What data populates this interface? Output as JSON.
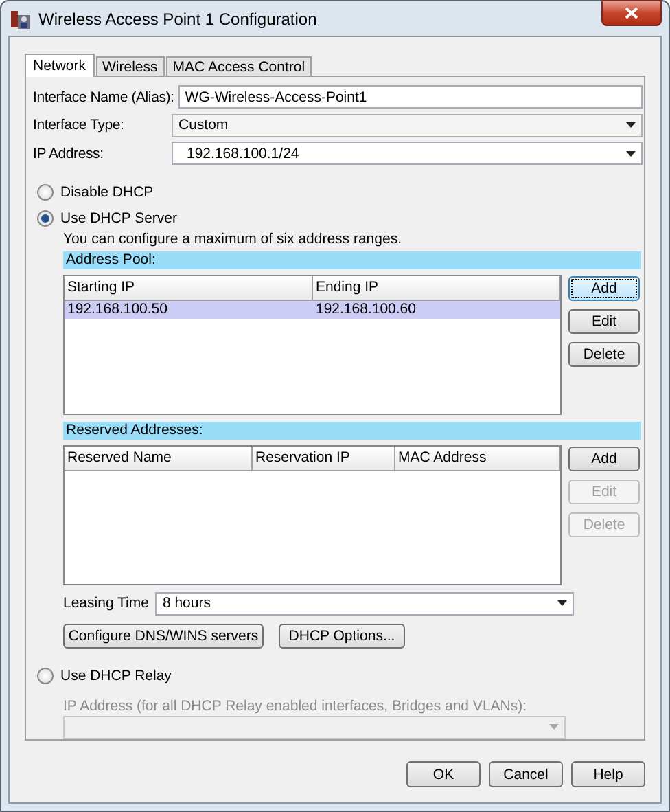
{
  "window": {
    "title": "Wireless Access Point 1 Configuration"
  },
  "tabs": [
    {
      "label": "Network",
      "selected": true
    },
    {
      "label": "Wireless",
      "selected": false
    },
    {
      "label": "MAC Access Control",
      "selected": false
    }
  ],
  "fields": [
    {
      "kind": "text",
      "label": "Interface Name (Alias):",
      "value": "WG-Wireless-Access-Point1"
    },
    {
      "kind": "select",
      "label": "Interface Type:",
      "value": "Custom"
    },
    {
      "kind": "combo",
      "label": "IP Address:",
      "value": "192.168.100.1/24"
    }
  ],
  "disable_dhcp": {
    "label": "Disable DHCP",
    "selected": false
  },
  "dhcp_server": {
    "label": "Use DHCP Server",
    "selected": true,
    "note": "You can configure a maximum of six address ranges.",
    "tables": [
      {
        "title": "Address Pool:",
        "columns": [
          "Starting IP",
          "Ending IP"
        ],
        "rows": [
          {
            "cells": [
              "192.168.100.50",
              "192.168.100.60"
            ],
            "selected": true
          }
        ],
        "buttons": [
          {
            "label": "Add",
            "disabled": false,
            "focused": true
          },
          {
            "label": "Edit",
            "disabled": false,
            "focused": false
          },
          {
            "label": "Delete",
            "disabled": false,
            "focused": false
          }
        ]
      },
      {
        "title": "Reserved Addresses:",
        "columns": [
          "Reserved Name",
          "Reservation IP",
          "MAC Address"
        ],
        "buttons": [
          {
            "label": "Add",
            "disabled": false,
            "focused": false
          },
          {
            "label": "Edit",
            "disabled": true,
            "focused": false
          },
          {
            "label": "Delete",
            "disabled": true,
            "focused": false
          }
        ]
      }
    ],
    "leasing_time": {
      "label": "Leasing Time",
      "value": "8 hours"
    },
    "buttons": [
      "Configure DNS/WINS servers",
      "DHCP Options..."
    ]
  },
  "dhcp_relay": {
    "label": "Use DHCP Relay",
    "selected": false,
    "field_label": "IP Address (for all DHCP Relay enabled interfaces, Bridges and VLANs):",
    "field_disabled": true
  },
  "buttons": [
    "OK",
    "Cancel",
    "Help"
  ]
}
